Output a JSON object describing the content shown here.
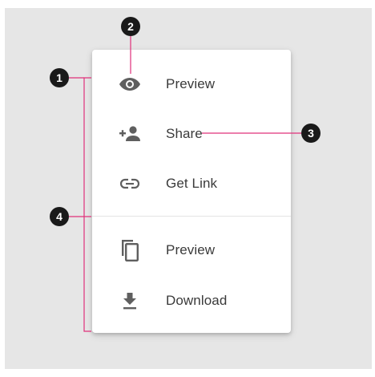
{
  "menu": {
    "items": [
      {
        "label": "Preview",
        "icon": "eye-icon"
      },
      {
        "label": "Share",
        "icon": "person-add-icon"
      },
      {
        "label": "Get Link",
        "icon": "link-icon"
      },
      {
        "label": "Preview",
        "icon": "copy-icon"
      },
      {
        "label": "Download",
        "icon": "download-icon"
      }
    ]
  },
  "callouts": {
    "c1": "1",
    "c2": "2",
    "c3": "3",
    "c4": "4"
  },
  "colors": {
    "annotation_line": "#e0307a",
    "callout_bg": "#1a1a1a",
    "icon": "#5f5f5f",
    "background": "#e6e6e6"
  }
}
